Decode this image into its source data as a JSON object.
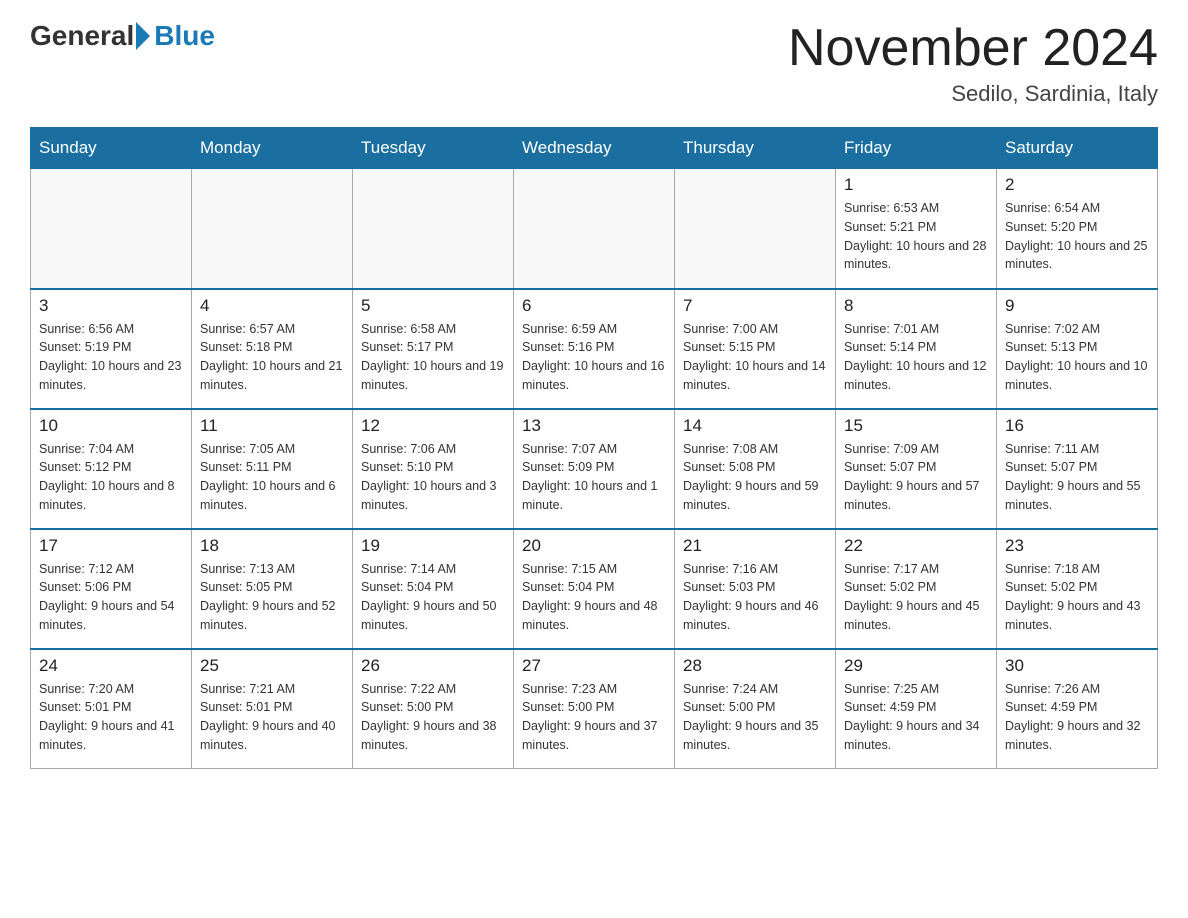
{
  "header": {
    "logo_general": "General",
    "logo_blue": "Blue",
    "month_title": "November 2024",
    "location": "Sedilo, Sardinia, Italy"
  },
  "days_of_week": [
    "Sunday",
    "Monday",
    "Tuesday",
    "Wednesday",
    "Thursday",
    "Friday",
    "Saturday"
  ],
  "weeks": [
    [
      {
        "day": "",
        "info": ""
      },
      {
        "day": "",
        "info": ""
      },
      {
        "day": "",
        "info": ""
      },
      {
        "day": "",
        "info": ""
      },
      {
        "day": "",
        "info": ""
      },
      {
        "day": "1",
        "info": "Sunrise: 6:53 AM\nSunset: 5:21 PM\nDaylight: 10 hours and 28 minutes."
      },
      {
        "day": "2",
        "info": "Sunrise: 6:54 AM\nSunset: 5:20 PM\nDaylight: 10 hours and 25 minutes."
      }
    ],
    [
      {
        "day": "3",
        "info": "Sunrise: 6:56 AM\nSunset: 5:19 PM\nDaylight: 10 hours and 23 minutes."
      },
      {
        "day": "4",
        "info": "Sunrise: 6:57 AM\nSunset: 5:18 PM\nDaylight: 10 hours and 21 minutes."
      },
      {
        "day": "5",
        "info": "Sunrise: 6:58 AM\nSunset: 5:17 PM\nDaylight: 10 hours and 19 minutes."
      },
      {
        "day": "6",
        "info": "Sunrise: 6:59 AM\nSunset: 5:16 PM\nDaylight: 10 hours and 16 minutes."
      },
      {
        "day": "7",
        "info": "Sunrise: 7:00 AM\nSunset: 5:15 PM\nDaylight: 10 hours and 14 minutes."
      },
      {
        "day": "8",
        "info": "Sunrise: 7:01 AM\nSunset: 5:14 PM\nDaylight: 10 hours and 12 minutes."
      },
      {
        "day": "9",
        "info": "Sunrise: 7:02 AM\nSunset: 5:13 PM\nDaylight: 10 hours and 10 minutes."
      }
    ],
    [
      {
        "day": "10",
        "info": "Sunrise: 7:04 AM\nSunset: 5:12 PM\nDaylight: 10 hours and 8 minutes."
      },
      {
        "day": "11",
        "info": "Sunrise: 7:05 AM\nSunset: 5:11 PM\nDaylight: 10 hours and 6 minutes."
      },
      {
        "day": "12",
        "info": "Sunrise: 7:06 AM\nSunset: 5:10 PM\nDaylight: 10 hours and 3 minutes."
      },
      {
        "day": "13",
        "info": "Sunrise: 7:07 AM\nSunset: 5:09 PM\nDaylight: 10 hours and 1 minute."
      },
      {
        "day": "14",
        "info": "Sunrise: 7:08 AM\nSunset: 5:08 PM\nDaylight: 9 hours and 59 minutes."
      },
      {
        "day": "15",
        "info": "Sunrise: 7:09 AM\nSunset: 5:07 PM\nDaylight: 9 hours and 57 minutes."
      },
      {
        "day": "16",
        "info": "Sunrise: 7:11 AM\nSunset: 5:07 PM\nDaylight: 9 hours and 55 minutes."
      }
    ],
    [
      {
        "day": "17",
        "info": "Sunrise: 7:12 AM\nSunset: 5:06 PM\nDaylight: 9 hours and 54 minutes."
      },
      {
        "day": "18",
        "info": "Sunrise: 7:13 AM\nSunset: 5:05 PM\nDaylight: 9 hours and 52 minutes."
      },
      {
        "day": "19",
        "info": "Sunrise: 7:14 AM\nSunset: 5:04 PM\nDaylight: 9 hours and 50 minutes."
      },
      {
        "day": "20",
        "info": "Sunrise: 7:15 AM\nSunset: 5:04 PM\nDaylight: 9 hours and 48 minutes."
      },
      {
        "day": "21",
        "info": "Sunrise: 7:16 AM\nSunset: 5:03 PM\nDaylight: 9 hours and 46 minutes."
      },
      {
        "day": "22",
        "info": "Sunrise: 7:17 AM\nSunset: 5:02 PM\nDaylight: 9 hours and 45 minutes."
      },
      {
        "day": "23",
        "info": "Sunrise: 7:18 AM\nSunset: 5:02 PM\nDaylight: 9 hours and 43 minutes."
      }
    ],
    [
      {
        "day": "24",
        "info": "Sunrise: 7:20 AM\nSunset: 5:01 PM\nDaylight: 9 hours and 41 minutes."
      },
      {
        "day": "25",
        "info": "Sunrise: 7:21 AM\nSunset: 5:01 PM\nDaylight: 9 hours and 40 minutes."
      },
      {
        "day": "26",
        "info": "Sunrise: 7:22 AM\nSunset: 5:00 PM\nDaylight: 9 hours and 38 minutes."
      },
      {
        "day": "27",
        "info": "Sunrise: 7:23 AM\nSunset: 5:00 PM\nDaylight: 9 hours and 37 minutes."
      },
      {
        "day": "28",
        "info": "Sunrise: 7:24 AM\nSunset: 5:00 PM\nDaylight: 9 hours and 35 minutes."
      },
      {
        "day": "29",
        "info": "Sunrise: 7:25 AM\nSunset: 4:59 PM\nDaylight: 9 hours and 34 minutes."
      },
      {
        "day": "30",
        "info": "Sunrise: 7:26 AM\nSunset: 4:59 PM\nDaylight: 9 hours and 32 minutes."
      }
    ]
  ]
}
